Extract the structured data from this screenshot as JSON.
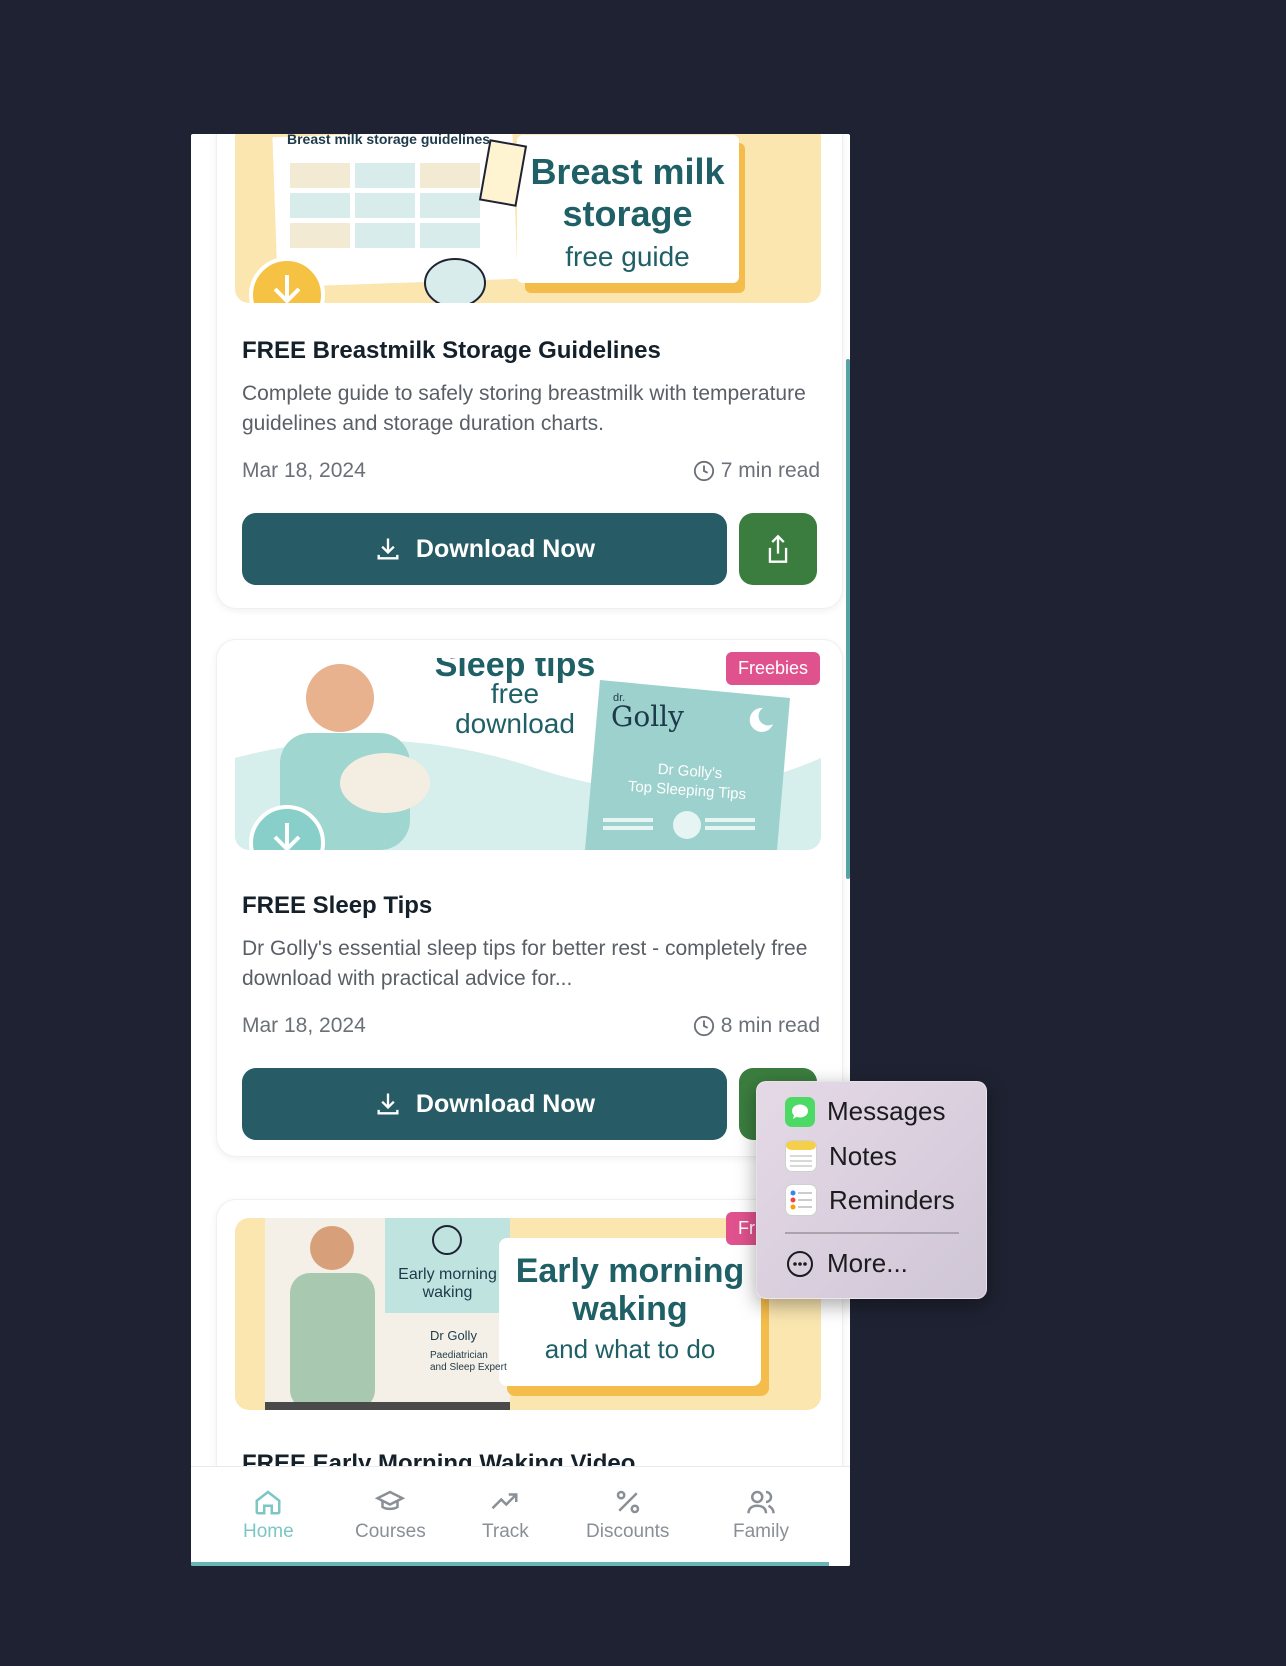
{
  "cards": [
    {
      "banner": {
        "heading": "Breast milk",
        "heading2": "storage",
        "sub": "free guide",
        "sheet_title": "Breast milk storage guidelines"
      },
      "title": "FREE Breastmilk Storage Guidelines",
      "description": "Complete guide to safely storing breastmilk with temperature guidelines and storage duration charts.",
      "date": "Mar 18, 2024",
      "read_time": "7 min read",
      "download_label": "Download Now"
    },
    {
      "badge": "Freebies",
      "banner": {
        "heading": "Sleep tips",
        "sub": "free",
        "sub2": "download",
        "book_brand": "Golly",
        "book_brand_prefix": "dr.",
        "book_title": "Dr Golly's",
        "book_title2": "Top Sleeping Tips"
      },
      "title": "FREE Sleep Tips",
      "description": "Dr Golly's essential sleep tips for better rest - completely free download with practical advice for...",
      "date": "Mar 18, 2024",
      "read_time": "8 min read",
      "download_label": "Download Now"
    },
    {
      "badge": "Fr",
      "banner": {
        "heading": "Early morning",
        "heading2": "waking",
        "sub": "and what to do",
        "panel_title": "Early morning",
        "panel_title2": "waking",
        "doctor": "Dr Golly",
        "doctor_role": "Paediatrician",
        "doctor_role2": "and Sleep Expert"
      },
      "title": "FREE Early Morning Waking Video"
    }
  ],
  "nav": [
    {
      "label": "Home",
      "icon": "home-icon",
      "active": true
    },
    {
      "label": "Courses",
      "icon": "graduation-cap-icon"
    },
    {
      "label": "Track",
      "icon": "trending-up-icon"
    },
    {
      "label": "Discounts",
      "icon": "percent-icon"
    },
    {
      "label": "Family",
      "icon": "users-icon"
    }
  ],
  "share_menu": {
    "items": [
      {
        "label": "Messages",
        "icon": "messages-icon"
      },
      {
        "label": "Notes",
        "icon": "notes-icon"
      },
      {
        "label": "Reminders",
        "icon": "reminders-icon"
      }
    ],
    "more_label": "More..."
  },
  "colors": {
    "accent": "#275c66",
    "share": "#3b7d3f",
    "badge": "#e0528e",
    "nav_active": "#7cc6c6"
  }
}
